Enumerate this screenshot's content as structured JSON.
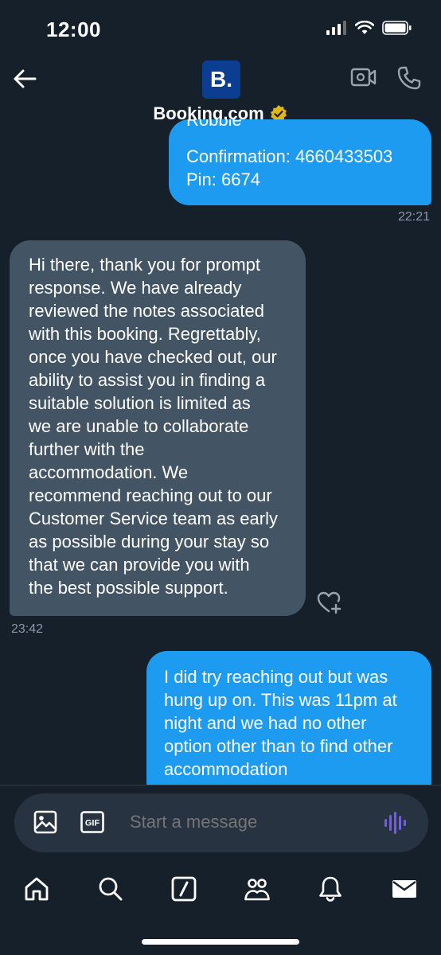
{
  "status_bar": {
    "time": "12:00"
  },
  "header": {
    "avatar_letter": "B.",
    "name": "Booking.com"
  },
  "messages": [
    {
      "direction": "sent",
      "partial_line": "Robbie",
      "lines": [
        "Confirmation: 4660433503",
        "Pin: 6674"
      ],
      "time": "22:21"
    },
    {
      "direction": "received",
      "lines": [
        "Hi there, thank you for prompt",
        "response. We have already",
        "reviewed the notes associated",
        "with this booking. Regrettably,",
        "once you have checked out, our",
        "ability to assist you in finding a",
        "suitable solution is limited as",
        "we are unable to collaborate",
        "further with the",
        "accommodation. We",
        "recommend reaching out to our",
        "Customer Service team as early",
        "as possible during your stay so",
        "that we can provide you with",
        "the best possible support."
      ],
      "time": "23:42"
    },
    {
      "direction": "sent",
      "lines": [
        "I did try reaching out but was",
        "hung up on. This was 11pm at",
        "night and we had no other",
        "option other than to find other",
        "accommodation"
      ]
    }
  ],
  "composer": {
    "placeholder": "Start a message",
    "gif_label": "GIF"
  },
  "nav": [
    "home-icon",
    "search-icon",
    "grok-icon",
    "communities-icon",
    "notifications-icon",
    "messages-icon"
  ],
  "colors": {
    "background": "#15202b",
    "sent_bubble": "#1d9bf0",
    "received_bubble": "#435464",
    "verified_badge": "#e2b719",
    "voice_accent": "#7856ff"
  }
}
